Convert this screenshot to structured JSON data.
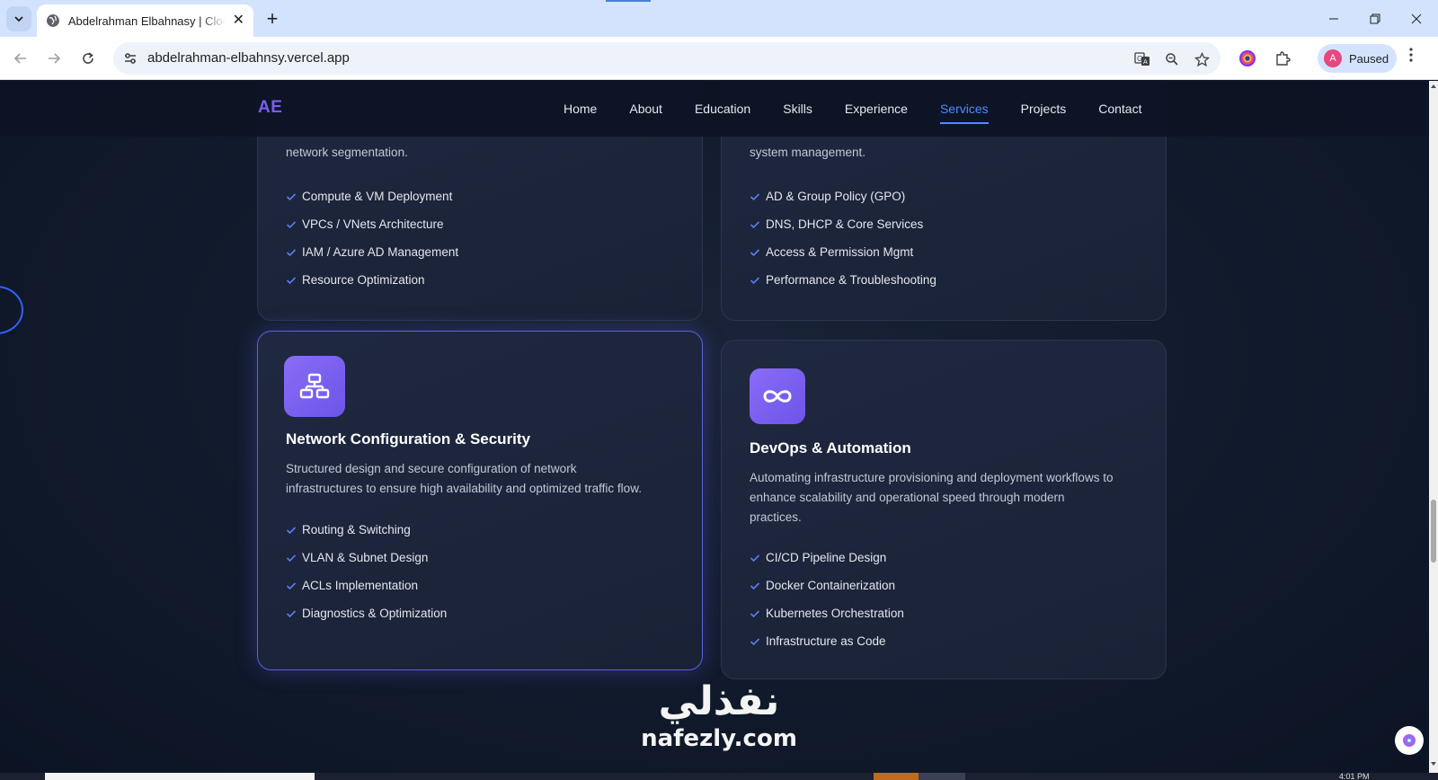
{
  "browser": {
    "tab_title": "Abdelrahman Elbahnasy | Cloud",
    "tab_close": "✕",
    "new_tab": "+",
    "url": "abdelrahman-elbahnsy.vercel.app",
    "profile_initial": "A",
    "profile_status": "Paused",
    "icons": [
      "tab-search-icon",
      "globe-icon",
      "close-icon",
      "plus-icon",
      "back-arrow-icon",
      "forward-arrow-icon",
      "reload-icon",
      "site-settings-icon",
      "translate-icon",
      "zoom-icon",
      "bookmark-star-icon",
      "chrome-extension-icon",
      "extensions-puzzle-icon",
      "more-menu-icon"
    ]
  },
  "site": {
    "logo": "AE",
    "nav": [
      {
        "label": "Home",
        "active": false
      },
      {
        "label": "About",
        "active": false
      },
      {
        "label": "Education",
        "active": false
      },
      {
        "label": "Skills",
        "active": false
      },
      {
        "label": "Experience",
        "active": false
      },
      {
        "label": "Services",
        "active": true
      },
      {
        "label": "Projects",
        "active": false
      },
      {
        "label": "Contact",
        "active": false
      }
    ],
    "accent": "#4f8cff",
    "brand": "#7c5cf0"
  },
  "cards": {
    "top_left": {
      "desc_tail": "network segmentation.",
      "features": [
        "Compute & VM Deployment",
        "VPCs / VNets Architecture",
        "IAM / Azure AD Management",
        "Resource Optimization"
      ]
    },
    "top_right": {
      "desc_tail": "system management.",
      "features": [
        "AD & Group Policy (GPO)",
        "DNS, DHCP & Core Services",
        "Access & Permission Mgmt",
        "Performance & Troubleshooting"
      ]
    },
    "network": {
      "icon": "network-topology-icon",
      "title": "Network Configuration & Security",
      "desc_1": "Structured design and secure configuration of network",
      "desc_2": "infrastructures to ensure high availability and optimized traffic flow.",
      "features": [
        "Routing & Switching",
        "VLAN & Subnet Design",
        "ACLs Implementation",
        "Diagnostics & Optimization"
      ]
    },
    "devops": {
      "icon": "infinity-icon",
      "title": "DevOps & Automation",
      "desc_1": "Automating infrastructure provisioning and deployment workflows to",
      "desc_2": "enhance scalability and operational speed through modern",
      "desc_3": "practices.",
      "features": [
        "CI/CD Pipeline Design",
        "Docker Containerization",
        "Kubernetes Orchestration",
        "Infrastructure as Code"
      ]
    }
  },
  "watermark": {
    "arabic": "نفذلي",
    "latin": "nafezly.com"
  },
  "taskbar": {
    "time": "4:01 PM"
  }
}
